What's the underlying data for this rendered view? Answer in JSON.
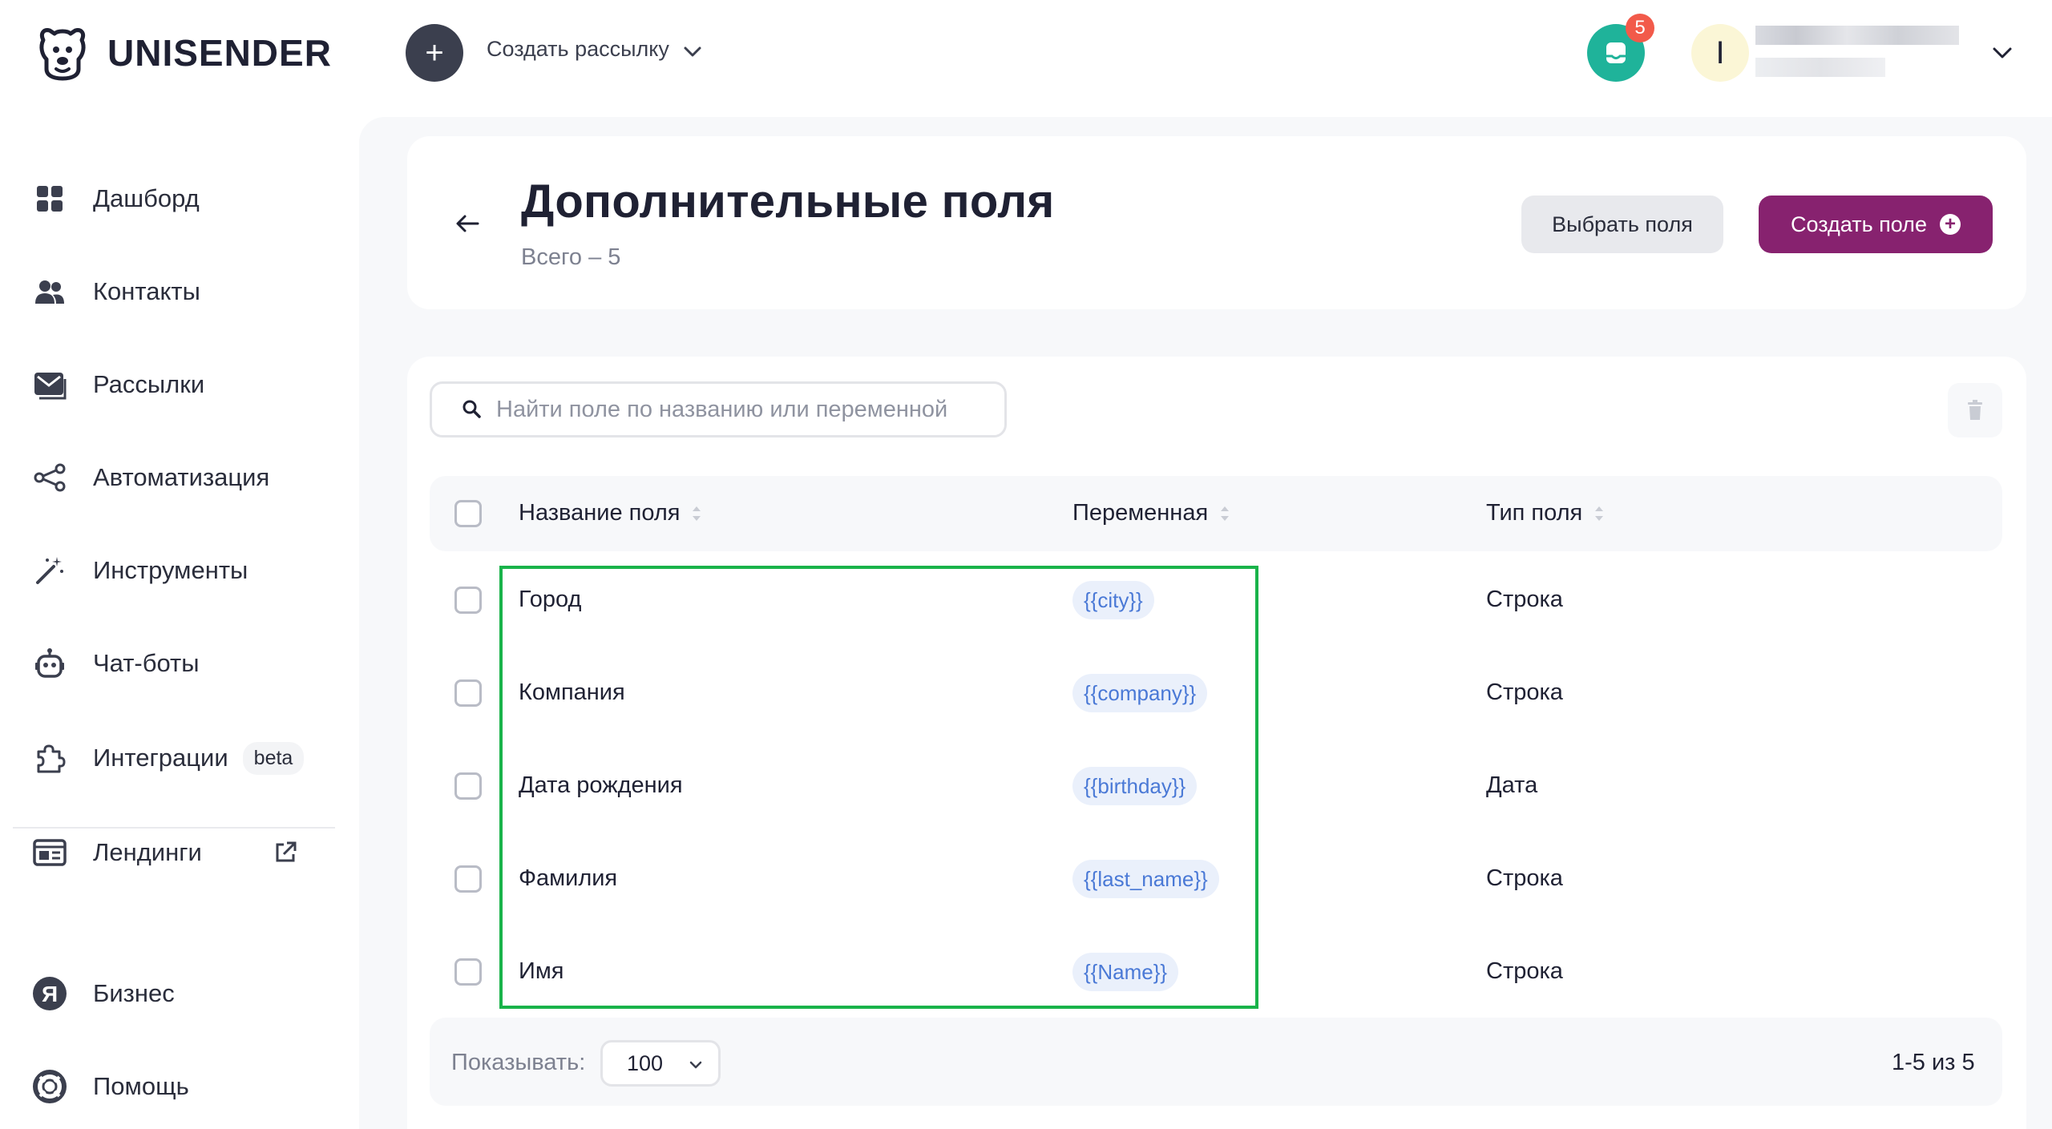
{
  "header": {
    "brand": "UNISENDER",
    "create_label": "Создать рассылку",
    "notifications_count": "5",
    "avatar_initial": "I"
  },
  "sidebar": {
    "items": [
      {
        "label": "Дашборд",
        "icon": "dashboard-icon"
      },
      {
        "label": "Контакты",
        "icon": "contacts-icon"
      },
      {
        "label": "Рассылки",
        "icon": "mail-icon"
      },
      {
        "label": "Автоматизация",
        "icon": "automation-icon"
      },
      {
        "label": "Инструменты",
        "icon": "magic-wand-icon"
      },
      {
        "label": "Чат-боты",
        "icon": "robot-icon"
      },
      {
        "label": "Интеграции",
        "icon": "puzzle-icon",
        "badge": "beta"
      },
      {
        "label": "Лендинги",
        "icon": "landing-icon"
      },
      {
        "label": "Бизнес",
        "icon": "yandex-icon"
      },
      {
        "label": "Помощь",
        "icon": "help-icon"
      }
    ]
  },
  "page": {
    "title": "Дополнительные поля",
    "subtitle": "Всего – 5",
    "select_button": "Выбрать поля",
    "create_button": "Создать поле"
  },
  "search": {
    "placeholder": "Найти поле по названию или переменной",
    "value": ""
  },
  "table": {
    "columns": [
      "Название поля",
      "Переменная",
      "Тип поля"
    ],
    "rows": [
      {
        "name": "Город",
        "variable": "{{city}}",
        "type": "Строка"
      },
      {
        "name": "Компания",
        "variable": "{{company}}",
        "type": "Строка"
      },
      {
        "name": "Дата рождения",
        "variable": "{{birthday}}",
        "type": "Дата"
      },
      {
        "name": "Фамилия",
        "variable": "{{last_name}}",
        "type": "Строка"
      },
      {
        "name": "Имя",
        "variable": "{{Name}}",
        "type": "Строка"
      }
    ]
  },
  "footer": {
    "show_label": "Показывать:",
    "per_page": "100",
    "range": "1-5 из 5"
  },
  "colors": {
    "accent": "#87226f",
    "highlight": "#19b34a",
    "notif": "#1fb39a",
    "badge": "#f25a4a"
  }
}
